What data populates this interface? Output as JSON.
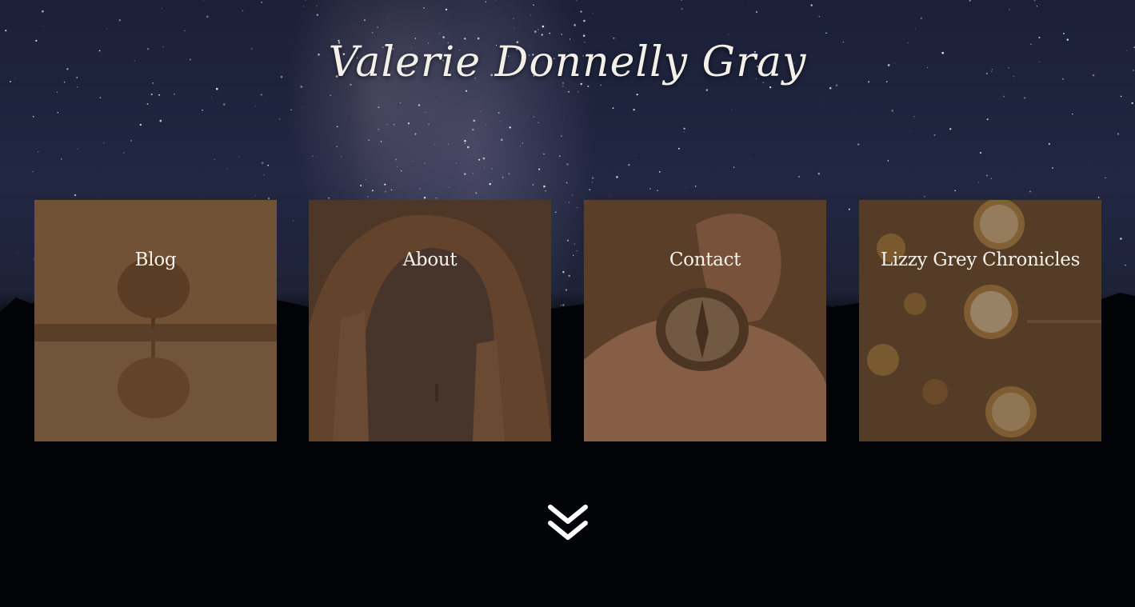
{
  "site": {
    "title": "Valerie Donnelly Gray"
  },
  "nav_tiles": [
    {
      "label": "Blog",
      "icon": "tree-reflection-photo"
    },
    {
      "label": "About",
      "icon": "rock-arch-night-photo"
    },
    {
      "label": "Contact",
      "icon": "compass-in-hand-photo"
    },
    {
      "label": "Lizzy Grey Chronicles",
      "icon": "pocket-watches-photo"
    }
  ],
  "scroll": {
    "icon": "double-chevron-down-icon"
  },
  "colors": {
    "title_text": "#f3f0ea",
    "tile_overlay": "#5c3e26",
    "sky": "#1d2238",
    "ground": "#040507"
  }
}
